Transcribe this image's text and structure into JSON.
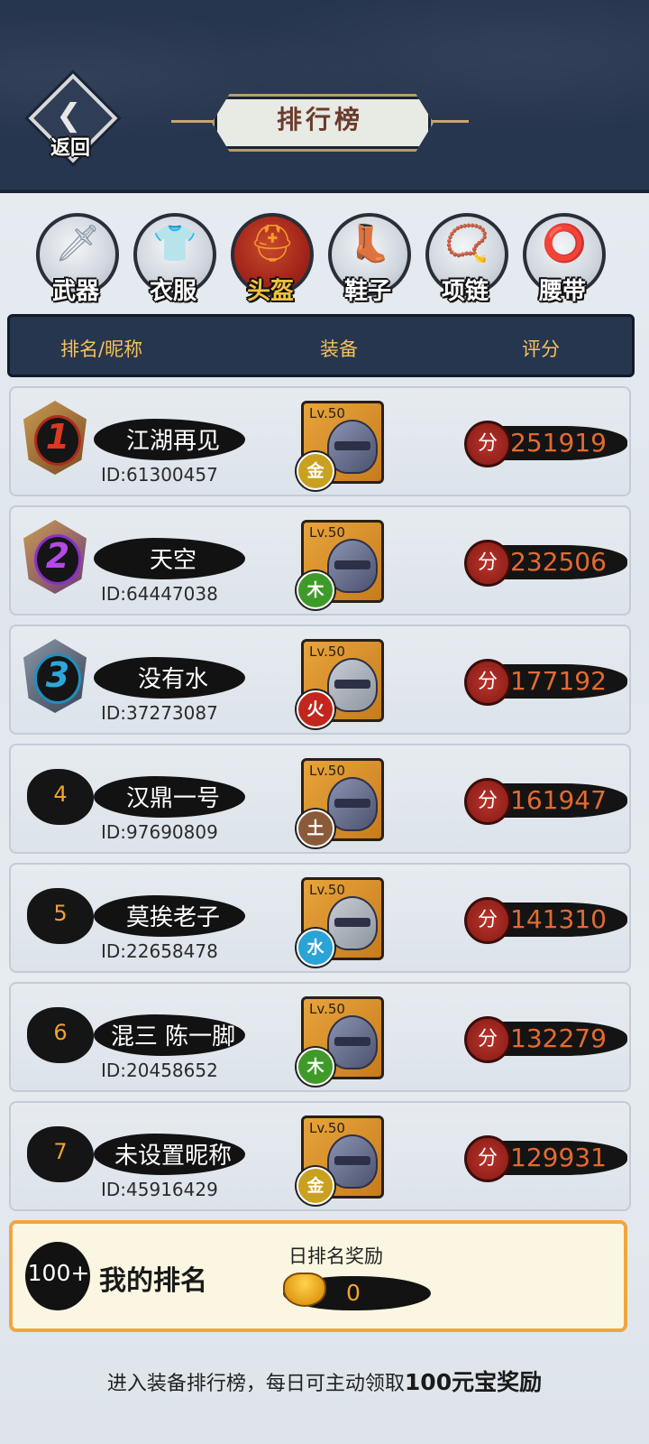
{
  "header": {
    "back_label": "返回",
    "title": "排行榜"
  },
  "tabs": [
    {
      "label": "武器",
      "icon": "sword-icon",
      "active": false
    },
    {
      "label": "衣服",
      "icon": "armor-icon",
      "active": false
    },
    {
      "label": "头盔",
      "icon": "helmet-icon",
      "active": true
    },
    {
      "label": "鞋子",
      "icon": "boot-icon",
      "active": false
    },
    {
      "label": "项链",
      "icon": "necklace-icon",
      "active": false
    },
    {
      "label": "腰带",
      "icon": "belt-icon",
      "active": false
    }
  ],
  "columns": {
    "rank_name": "排名/昵称",
    "equip": "装备",
    "score": "评分"
  },
  "rows": [
    {
      "rank": "1",
      "name": "江湖再见",
      "id": "ID:61300457",
      "lv": "Lv.50",
      "element": "金",
      "score": "251919"
    },
    {
      "rank": "2",
      "name": "天空",
      "id": "ID:64447038",
      "lv": "Lv.50",
      "element": "木",
      "score": "232506"
    },
    {
      "rank": "3",
      "name": "没有水",
      "id": "ID:37273087",
      "lv": "Lv.50",
      "element": "火",
      "score": "177192"
    },
    {
      "rank": "4",
      "name": "汉鼎一号",
      "id": "ID:97690809",
      "lv": "Lv.50",
      "element": "土",
      "score": "161947"
    },
    {
      "rank": "5",
      "name": "莫挨老子",
      "id": "ID:22658478",
      "lv": "Lv.50",
      "element": "水",
      "score": "141310"
    },
    {
      "rank": "6",
      "name": "混三 陈一脚",
      "id": "ID:20458652",
      "lv": "Lv.50",
      "element": "木",
      "score": "132279"
    },
    {
      "rank": "7",
      "name": "未设置昵称",
      "id": "ID:45916429",
      "lv": "Lv.50",
      "element": "金",
      "score": "129931"
    }
  ],
  "score_prefix": "分",
  "my_rank": {
    "rank": "100+",
    "title": "我的排名",
    "reward_label": "日排名奖励",
    "reward_value": "0"
  },
  "footer": {
    "text": "进入装备排行榜，每日可主动领取",
    "highlight": "100元宝奖励"
  },
  "colors": {
    "header_bg": "#27364f",
    "accent_orange": "#f0a640",
    "score_text": "#e46a2f",
    "element_gold": "#c9a020",
    "element_wood": "#3f9a2a",
    "element_fire": "#c3261d",
    "element_earth": "#8a5a3a",
    "element_water": "#2aa3d6"
  }
}
